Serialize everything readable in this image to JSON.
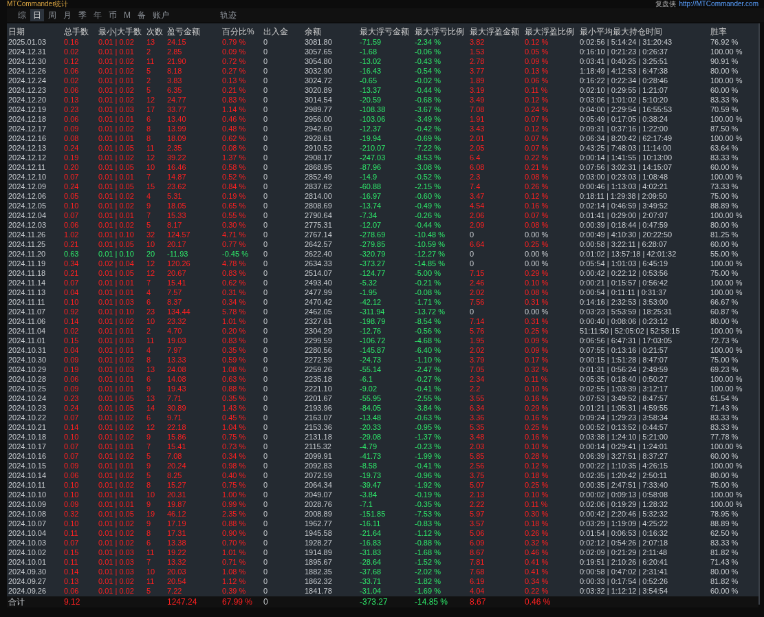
{
  "title_bar": {
    "title": "MTCommander统计",
    "brand": "复盘侠",
    "link": "http://MTCommander.com"
  },
  "tabs": [
    {
      "label": "综",
      "selected": false
    },
    {
      "label": "日",
      "selected": true
    },
    {
      "label": "周",
      "selected": false
    },
    {
      "label": "月",
      "selected": false
    },
    {
      "label": "季",
      "selected": false
    },
    {
      "label": "年",
      "selected": false
    },
    {
      "label": "币",
      "selected": false
    },
    {
      "label": "M",
      "selected": false
    },
    {
      "label": "备",
      "selected": false
    },
    {
      "label": "账户",
      "selected": false
    },
    {
      "label": "轨迹",
      "selected": false
    }
  ],
  "table": {
    "columns": [
      "日期",
      "总手数",
      "最小|大手数",
      "次数",
      "盈亏金额",
      "百分比%",
      "出入金",
      "余额",
      "最大浮亏金额",
      "最大浮亏比例",
      "最大浮盈金额",
      "最大浮盈比例",
      "最小平均最大持仓时间",
      "胜率"
    ],
    "rows": [
      {
        "loss": false,
        "float_gain": true,
        "cells": [
          "2025.01.03",
          "0.16",
          "0.01 | 0.02",
          "13",
          "24.15",
          "0.79 %",
          "0",
          "3081.80",
          "-71.59",
          "-2.34 %",
          "3.82",
          "0.12 %",
          "0:02:56 | 5:14:24 | 31:20:43",
          "76.92 %"
        ]
      },
      {
        "loss": false,
        "float_gain": true,
        "cells": [
          "2024.12.31",
          "0.02",
          "0.01 | 0.01",
          "2",
          "2.85",
          "0.09 %",
          "0",
          "3057.65",
          "-1.68",
          "-0.06 %",
          "1.53",
          "0.05 %",
          "0:16:10 | 0:21:23 | 0:26:37",
          "100.00 %"
        ]
      },
      {
        "loss": false,
        "float_gain": true,
        "cells": [
          "2024.12.30",
          "0.12",
          "0.01 | 0.02",
          "11",
          "21.90",
          "0.72 %",
          "0",
          "3054.80",
          "-13.02",
          "-0.43 %",
          "2.78",
          "0.09 %",
          "0:03:41 | 0:40:25 | 3:25:51",
          "90.91 %"
        ]
      },
      {
        "loss": false,
        "float_gain": true,
        "cells": [
          "2024.12.26",
          "0.06",
          "0.01 | 0.02",
          "5",
          "8.18",
          "0.27 %",
          "0",
          "3032.90",
          "-16.43",
          "-0.54 %",
          "3.77",
          "0.13 %",
          "1:18:49 | 4:12:53 | 6:47:38",
          "80.00 %"
        ]
      },
      {
        "loss": false,
        "float_gain": true,
        "cells": [
          "2024.12.24",
          "0.02",
          "0.01 | 0.01",
          "2",
          "3.83",
          "0.13 %",
          "0",
          "3024.72",
          "-0.65",
          "-0.02 %",
          "1.89",
          "0.06 %",
          "0:16:22 | 0:22:34 | 0:28:46",
          "100.00 %"
        ]
      },
      {
        "loss": false,
        "float_gain": true,
        "cells": [
          "2024.12.23",
          "0.06",
          "0.01 | 0.02",
          "5",
          "6.35",
          "0.21 %",
          "0",
          "3020.89",
          "-13.37",
          "-0.44 %",
          "3.19",
          "0.11 %",
          "0:02:10 | 0:29:55 | 1:21:07",
          "60.00 %"
        ]
      },
      {
        "loss": false,
        "float_gain": true,
        "cells": [
          "2024.12.20",
          "0.13",
          "0.01 | 0.02",
          "12",
          "24.77",
          "0.83 %",
          "0",
          "3014.54",
          "-20.59",
          "-0.68 %",
          "3.49",
          "0.12 %",
          "0:03:06 | 1:01:02 | 5:10:20",
          "83.33 %"
        ]
      },
      {
        "loss": false,
        "float_gain": true,
        "cells": [
          "2024.12.19",
          "0.23",
          "0.01 | 0.03",
          "17",
          "33.77",
          "1.14 %",
          "0",
          "2989.77",
          "-108.38",
          "-3.67 %",
          "7.08",
          "0.24 %",
          "0:04:00 | 2:29:54 | 16:55:53",
          "70.59 %"
        ]
      },
      {
        "loss": false,
        "float_gain": true,
        "cells": [
          "2024.12.18",
          "0.06",
          "0.01 | 0.01",
          "6",
          "13.40",
          "0.46 %",
          "0",
          "2956.00",
          "-103.06",
          "-3.49 %",
          "1.91",
          "0.07 %",
          "0:05:49 | 0:17:05 | 0:38:24",
          "100.00 %"
        ]
      },
      {
        "loss": false,
        "float_gain": true,
        "cells": [
          "2024.12.17",
          "0.09",
          "0.01 | 0.02",
          "8",
          "13.99",
          "0.48 %",
          "0",
          "2942.60",
          "-12.37",
          "-0.42 %",
          "3.43",
          "0.12 %",
          "0:09:31 | 0:37:16 | 1:22:00",
          "87.50 %"
        ]
      },
      {
        "loss": false,
        "float_gain": true,
        "cells": [
          "2024.12.16",
          "0.08",
          "0.01 | 0.01",
          "8",
          "18.09",
          "0.62 %",
          "0",
          "2928.61",
          "-19.94",
          "-0.69 %",
          "2.01",
          "0.07 %",
          "0:06:34 | 8:20:42 | 62:17:49",
          "100.00 %"
        ]
      },
      {
        "loss": false,
        "float_gain": true,
        "cells": [
          "2024.12.13",
          "0.24",
          "0.01 | 0.05",
          "11",
          "2.35",
          "0.08 %",
          "0",
          "2910.52",
          "-210.07",
          "-7.22 %",
          "2.05",
          "0.07 %",
          "0:43:25 | 7:48:03 | 11:14:00",
          "63.64 %"
        ]
      },
      {
        "loss": false,
        "float_gain": true,
        "cells": [
          "2024.12.12",
          "0.19",
          "0.01 | 0.02",
          "12",
          "39.22",
          "1.37 %",
          "0",
          "2908.17",
          "-247.03",
          "-8.53 %",
          "6.4",
          "0.22 %",
          "0:00:14 | 1:41:55 | 10:13:00",
          "83.33 %"
        ]
      },
      {
        "loss": false,
        "float_gain": true,
        "cells": [
          "2024.12.11",
          "0.20",
          "0.01 | 0.05",
          "10",
          "16.46",
          "0.58 %",
          "0",
          "2868.95",
          "-87.96",
          "-3.08 %",
          "6.08",
          "0.21 %",
          "0:07:56 | 3:02:31 | 14:15:07",
          "60.00 %"
        ]
      },
      {
        "loss": false,
        "float_gain": true,
        "cells": [
          "2024.12.10",
          "0.07",
          "0.01 | 0.01",
          "7",
          "14.87",
          "0.52 %",
          "0",
          "2852.49",
          "-14.9",
          "-0.52 %",
          "2.3",
          "0.08 %",
          "0:03:00 | 0:23:03 | 1:08:48",
          "100.00 %"
        ]
      },
      {
        "loss": false,
        "float_gain": true,
        "cells": [
          "2024.12.09",
          "0.24",
          "0.01 | 0.05",
          "15",
          "23.62",
          "0.84 %",
          "0",
          "2837.62",
          "-60.88",
          "-2.15 %",
          "7.4",
          "0.26 %",
          "0:00:46 | 1:13:03 | 4:02:21",
          "73.33 %"
        ]
      },
      {
        "loss": false,
        "float_gain": true,
        "cells": [
          "2024.12.06",
          "0.05",
          "0.01 | 0.02",
          "4",
          "5.31",
          "0.19 %",
          "0",
          "2814.00",
          "-16.97",
          "-0.60 %",
          "3.47",
          "0.12 %",
          "0:18:11 | 1:29:38 | 2:09:50",
          "75.00 %"
        ]
      },
      {
        "loss": false,
        "float_gain": true,
        "cells": [
          "2024.12.05",
          "0.10",
          "0.01 | 0.02",
          "9",
          "18.05",
          "0.65 %",
          "0",
          "2808.69",
          "-13.74",
          "-0.49 %",
          "4.54",
          "0.16 %",
          "0:02:14 | 0:46:59 | 3:49:52",
          "88.89 %"
        ]
      },
      {
        "loss": false,
        "float_gain": true,
        "cells": [
          "2024.12.04",
          "0.07",
          "0.01 | 0.01",
          "7",
          "15.33",
          "0.55 %",
          "0",
          "2790.64",
          "-7.34",
          "-0.26 %",
          "2.06",
          "0.07 %",
          "0:01:41 | 0:29:00 | 2:07:07",
          "100.00 %"
        ]
      },
      {
        "loss": false,
        "float_gain": true,
        "cells": [
          "2024.12.03",
          "0.06",
          "0.01 | 0.02",
          "5",
          "8.17",
          "0.30 %",
          "0",
          "2775.31",
          "-12.07",
          "-0.44 %",
          "2.09",
          "0.08 %",
          "0:00:39 | 0:18:44 | 0:47:59",
          "80.00 %"
        ]
      },
      {
        "loss": false,
        "float_gain": false,
        "cells": [
          "2024.11.26",
          "1.02",
          "0.01 | 0.10",
          "32",
          "124.57",
          "4.71 %",
          "0",
          "2767.14",
          "-278.69",
          "-10.48 %",
          "0",
          "0.00 %",
          "0:00:49 | 4:10:30 | 20:22:50",
          "81.25 %"
        ]
      },
      {
        "loss": false,
        "float_gain": true,
        "cells": [
          "2024.11.25",
          "0.21",
          "0.01 | 0.05",
          "10",
          "20.17",
          "0.77 %",
          "0",
          "2642.57",
          "-279.85",
          "-10.59 %",
          "6.64",
          "0.25 %",
          "0:00:58 | 3:22:11 | 6:28:07",
          "60.00 %"
        ]
      },
      {
        "loss": true,
        "float_gain": false,
        "cells": [
          "2024.11.20",
          "0.63",
          "0.01 | 0.10",
          "20",
          "-11.93",
          "-0.45 %",
          "0",
          "2622.40",
          "-320.79",
          "-12.27 %",
          "0",
          "0.00 %",
          "0:01:02 | 13:57:18 | 42:01:32",
          "55.00 %"
        ]
      },
      {
        "loss": false,
        "float_gain": false,
        "cells": [
          "2024.11.19",
          "0.34",
          "0.02 | 0.04",
          "12",
          "120.26",
          "4.78 %",
          "0",
          "2634.33",
          "-373.27",
          "-14.85 %",
          "0",
          "0.00 %",
          "0:05:54 | 1:01:03 | 6:45:19",
          "100.00 %"
        ]
      },
      {
        "loss": false,
        "float_gain": true,
        "cells": [
          "2024.11.18",
          "0.21",
          "0.01 | 0.05",
          "12",
          "20.67",
          "0.83 %",
          "0",
          "2514.07",
          "-124.77",
          "-5.00 %",
          "7.15",
          "0.29 %",
          "0:00:42 | 0:22:12 | 0:53:56",
          "75.00 %"
        ]
      },
      {
        "loss": false,
        "float_gain": true,
        "cells": [
          "2024.11.14",
          "0.07",
          "0.01 | 0.01",
          "7",
          "15.41",
          "0.62 %",
          "0",
          "2493.40",
          "-5.32",
          "-0.21 %",
          "2.46",
          "0.10 %",
          "0:00:21 | 0:15:57 | 0:56:42",
          "100.00 %"
        ]
      },
      {
        "loss": false,
        "float_gain": true,
        "cells": [
          "2024.11.13",
          "0.04",
          "0.01 | 0.01",
          "4",
          "7.57",
          "0.31 %",
          "0",
          "2477.99",
          "-1.95",
          "-0.08 %",
          "2.02",
          "0.08 %",
          "0:00:54 | 0:11:11 | 0:31:37",
          "100.00 %"
        ]
      },
      {
        "loss": false,
        "float_gain": true,
        "cells": [
          "2024.11.11",
          "0.10",
          "0.01 | 0.03",
          "6",
          "8.37",
          "0.34 %",
          "0",
          "2470.42",
          "-42.12",
          "-1.71 %",
          "7.56",
          "0.31 %",
          "0:14:16 | 2:32:53 | 3:53:00",
          "66.67 %"
        ]
      },
      {
        "loss": false,
        "float_gain": false,
        "cells": [
          "2024.11.07",
          "0.92",
          "0.01 | 0.10",
          "23",
          "134.44",
          "5.78 %",
          "0",
          "2462.05",
          "-311.94",
          "-13.72 %",
          "0",
          "0.00 %",
          "0:03:23 | 5:53:59 | 18:25:31",
          "60.87 %"
        ]
      },
      {
        "loss": false,
        "float_gain": true,
        "cells": [
          "2024.11.06",
          "0.14",
          "0.01 | 0.02",
          "10",
          "23.32",
          "1.01 %",
          "0",
          "2327.61",
          "-198.79",
          "-8.54 %",
          "7.14",
          "0.31 %",
          "0:00:40 | 0:08:06 | 0:23:12",
          "80.00 %"
        ]
      },
      {
        "loss": false,
        "float_gain": true,
        "cells": [
          "2024.11.04",
          "0.02",
          "0.01 | 0.01",
          "2",
          "4.70",
          "0.20 %",
          "0",
          "2304.29",
          "-12.76",
          "-0.56 %",
          "5.76",
          "0.25 %",
          "51:11:50 | 52:05:02 | 52:58:15",
          "100.00 %"
        ]
      },
      {
        "loss": false,
        "float_gain": true,
        "cells": [
          "2024.11.01",
          "0.15",
          "0.01 | 0.03",
          "11",
          "19.03",
          "0.83 %",
          "0",
          "2299.59",
          "-106.72",
          "-4.68 %",
          "1.95",
          "0.09 %",
          "0:06:56 | 6:47:31 | 17:03:05",
          "72.73 %"
        ]
      },
      {
        "loss": false,
        "float_gain": true,
        "cells": [
          "2024.10.31",
          "0.04",
          "0.01 | 0.01",
          "4",
          "7.97",
          "0.35 %",
          "0",
          "2280.56",
          "-145.87",
          "-6.40 %",
          "2.02",
          "0.09 %",
          "0:07:55 | 0:13:16 | 0:21:57",
          "100.00 %"
        ]
      },
      {
        "loss": false,
        "float_gain": true,
        "cells": [
          "2024.10.30",
          "0.09",
          "0.01 | 0.02",
          "8",
          "13.33",
          "0.59 %",
          "0",
          "2272.59",
          "-24.73",
          "-1.10 %",
          "3.79",
          "0.17 %",
          "0:00:15 | 1:51:28 | 8:47:07",
          "75.00 %"
        ]
      },
      {
        "loss": false,
        "float_gain": true,
        "cells": [
          "2024.10.29",
          "0.19",
          "0.01 | 0.03",
          "13",
          "24.08",
          "1.08 %",
          "0",
          "2259.26",
          "-55.14",
          "-2.47 %",
          "7.05",
          "0.32 %",
          "0:01:31 | 0:56:24 | 2:49:59",
          "69.23 %"
        ]
      },
      {
        "loss": false,
        "float_gain": true,
        "cells": [
          "2024.10.28",
          "0.06",
          "0.01 | 0.01",
          "6",
          "14.08",
          "0.63 %",
          "0",
          "2235.18",
          "-6.1",
          "-0.27 %",
          "2.34",
          "0.11 %",
          "0:05:35 | 0:18:40 | 0:50:27",
          "100.00 %"
        ]
      },
      {
        "loss": false,
        "float_gain": true,
        "cells": [
          "2024.10.25",
          "0.09",
          "0.01 | 0.01",
          "9",
          "19.43",
          "0.88 %",
          "0",
          "2221.10",
          "-9.02",
          "-0.41 %",
          "2.2",
          "0.10 %",
          "0:02:55 | 1:03:39 | 3:12:17",
          "100.00 %"
        ]
      },
      {
        "loss": false,
        "float_gain": true,
        "cells": [
          "2024.10.24",
          "0.23",
          "0.01 | 0.05",
          "13",
          "7.71",
          "0.35 %",
          "0",
          "2201.67",
          "-55.95",
          "-2.55 %",
          "3.55",
          "0.16 %",
          "0:07:53 | 3:49:52 | 8:47:57",
          "61.54 %"
        ]
      },
      {
        "loss": false,
        "float_gain": true,
        "cells": [
          "2024.10.23",
          "0.24",
          "0.01 | 0.05",
          "14",
          "30.89",
          "1.43 %",
          "0",
          "2193.96",
          "-84.05",
          "-3.84 %",
          "6.34",
          "0.29 %",
          "0:01:21 | 1:05:31 | 4:59:55",
          "71.43 %"
        ]
      },
      {
        "loss": false,
        "float_gain": true,
        "cells": [
          "2024.10.22",
          "0.07",
          "0.01 | 0.02",
          "6",
          "9.71",
          "0.45 %",
          "0",
          "2163.07",
          "-13.48",
          "-0.63 %",
          "3.36",
          "0.16 %",
          "0:09:24 | 1:29:23 | 3:58:34",
          "83.33 %"
        ]
      },
      {
        "loss": false,
        "float_gain": true,
        "cells": [
          "2024.10.21",
          "0.14",
          "0.01 | 0.02",
          "12",
          "22.18",
          "1.04 %",
          "0",
          "2153.36",
          "-20.33",
          "-0.95 %",
          "5.35",
          "0.25 %",
          "0:00:52 | 0:13:52 | 0:44:57",
          "83.33 %"
        ]
      },
      {
        "loss": false,
        "float_gain": true,
        "cells": [
          "2024.10.18",
          "0.10",
          "0.01 | 0.02",
          "9",
          "15.86",
          "0.75 %",
          "0",
          "2131.18",
          "-29.08",
          "-1.37 %",
          "3.48",
          "0.16 %",
          "0:03:38 | 1:24:10 | 5:21:00",
          "77.78 %"
        ]
      },
      {
        "loss": false,
        "float_gain": true,
        "cells": [
          "2024.10.17",
          "0.07",
          "0.01 | 0.01",
          "7",
          "15.41",
          "0.73 %",
          "0",
          "2115.32",
          "-4.79",
          "-0.23 %",
          "2.03",
          "0.10 %",
          "0:00:14 | 0:29:41 | 1:24:01",
          "100.00 %"
        ]
      },
      {
        "loss": false,
        "float_gain": true,
        "cells": [
          "2024.10.16",
          "0.07",
          "0.01 | 0.02",
          "5",
          "7.08",
          "0.34 %",
          "0",
          "2099.91",
          "-41.73",
          "-1.99 %",
          "5.85",
          "0.28 %",
          "0:06:39 | 3:27:51 | 8:37:27",
          "60.00 %"
        ]
      },
      {
        "loss": false,
        "float_gain": true,
        "cells": [
          "2024.10.15",
          "0.09",
          "0.01 | 0.01",
          "9",
          "20.24",
          "0.98 %",
          "0",
          "2092.83",
          "-8.58",
          "-0.41 %",
          "2.56",
          "0.12 %",
          "0:00:22 | 1:10:35 | 4:26:15",
          "100.00 %"
        ]
      },
      {
        "loss": false,
        "float_gain": true,
        "cells": [
          "2024.10.14",
          "0.06",
          "0.01 | 0.02",
          "5",
          "8.25",
          "0.40 %",
          "0",
          "2072.59",
          "-19.73",
          "-0.96 %",
          "3.75",
          "0.18 %",
          "0:02:35 | 1:20:42 | 2:50:11",
          "80.00 %"
        ]
      },
      {
        "loss": false,
        "float_gain": true,
        "cells": [
          "2024.10.11",
          "0.10",
          "0.01 | 0.02",
          "8",
          "15.27",
          "0.75 %",
          "0",
          "2064.34",
          "-39.47",
          "-1.92 %",
          "5.07",
          "0.25 %",
          "0:00:35 | 2:47:51 | 7:33:40",
          "75.00 %"
        ]
      },
      {
        "loss": false,
        "float_gain": true,
        "cells": [
          "2024.10.10",
          "0.10",
          "0.01 | 0.01",
          "10",
          "20.31",
          "1.00 %",
          "0",
          "2049.07",
          "-3.84",
          "-0.19 %",
          "2.13",
          "0.10 %",
          "0:00:02 | 0:09:13 | 0:58:08",
          "100.00 %"
        ]
      },
      {
        "loss": false,
        "float_gain": true,
        "cells": [
          "2024.10.09",
          "0.09",
          "0.01 | 0.01",
          "9",
          "19.87",
          "0.99 %",
          "0",
          "2028.76",
          "-7.1",
          "-0.35 %",
          "2.22",
          "0.11 %",
          "0:02:06 | 0:19:29 | 1:28:32",
          "100.00 %"
        ]
      },
      {
        "loss": false,
        "float_gain": true,
        "cells": [
          "2024.10.08",
          "0.32",
          "0.01 | 0.05",
          "19",
          "46.12",
          "2.35 %",
          "0",
          "2008.89",
          "-151.85",
          "-7.53 %",
          "5.97",
          "0.30 %",
          "0:00:42 | 2:20:46 | 5:32:32",
          "78.95 %"
        ]
      },
      {
        "loss": false,
        "float_gain": true,
        "cells": [
          "2024.10.07",
          "0.10",
          "0.01 | 0.02",
          "9",
          "17.19",
          "0.88 %",
          "0",
          "1962.77",
          "-16.11",
          "-0.83 %",
          "3.57",
          "0.18 %",
          "0:03:29 | 1:19:09 | 4:25:22",
          "88.89 %"
        ]
      },
      {
        "loss": false,
        "float_gain": true,
        "cells": [
          "2024.10.04",
          "0.11",
          "0.01 | 0.02",
          "8",
          "17.31",
          "0.90 %",
          "0",
          "1945.58",
          "-21.64",
          "-1.12 %",
          "5.06",
          "0.26 %",
          "0:01:54 | 0:06:53 | 0:16:32",
          "62.50 %"
        ]
      },
      {
        "loss": false,
        "float_gain": true,
        "cells": [
          "2024.10.03",
          "0.07",
          "0.01 | 0.02",
          "6",
          "13.38",
          "0.70 %",
          "0",
          "1928.27",
          "-16.83",
          "-0.88 %",
          "6.09",
          "0.32 %",
          "0:02:12 | 0:54:26 | 2:07:18",
          "83.33 %"
        ]
      },
      {
        "loss": false,
        "float_gain": true,
        "cells": [
          "2024.10.02",
          "0.15",
          "0.01 | 0.03",
          "11",
          "19.22",
          "1.01 %",
          "0",
          "1914.89",
          "-31.83",
          "-1.68 %",
          "8.67",
          "0.46 %",
          "0:02:09 | 0:21:29 | 2:11:48",
          "81.82 %"
        ]
      },
      {
        "loss": false,
        "float_gain": true,
        "cells": [
          "2024.10.01",
          "0.11",
          "0.01 | 0.03",
          "7",
          "13.32",
          "0.71 %",
          "0",
          "1895.67",
          "-28.64",
          "-1.52 %",
          "7.81",
          "0.41 %",
          "0:19:51 | 2:10:26 | 6:20:41",
          "71.43 %"
        ]
      },
      {
        "loss": false,
        "float_gain": true,
        "cells": [
          "2024.09.30",
          "0.14",
          "0.01 | 0.03",
          "10",
          "20.03",
          "1.08 %",
          "0",
          "1882.35",
          "-37.68",
          "-2.02 %",
          "7.68",
          "0.41 %",
          "0:00:58 | 0:47:02 | 2:31:41",
          "80.00 %"
        ]
      },
      {
        "loss": false,
        "float_gain": true,
        "cells": [
          "2024.09.27",
          "0.13",
          "0.01 | 0.02",
          "11",
          "20.54",
          "1.12 %",
          "0",
          "1862.32",
          "-33.71",
          "-1.82 %",
          "6.19",
          "0.34 %",
          "0:00:33 | 0:17:54 | 0:52:26",
          "81.82 %"
        ]
      },
      {
        "loss": false,
        "float_gain": true,
        "cells": [
          "2024.09.26",
          "0.06",
          "0.01 | 0.02",
          "5",
          "7.22",
          "0.39 %",
          "0",
          "1841.78",
          "-31.04",
          "-1.69 %",
          "4.04",
          "0.22 %",
          "0:03:32 | 1:12:12 | 3:54:54",
          "60.00 %"
        ]
      }
    ],
    "total": {
      "loss": false,
      "float_gain": true,
      "cells": [
        "合计",
        "9.12",
        null,
        null,
        "1247.24",
        "67.99 %",
        "0",
        null,
        "-373.27",
        "-14.85 %",
        "8.67",
        "0.46 %",
        null,
        null
      ]
    }
  }
}
